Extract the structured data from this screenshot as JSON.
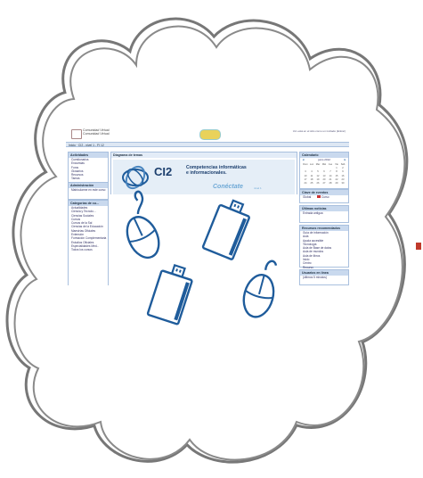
{
  "page": {
    "header": {
      "logo_text_line1": "Comunidad Virtual",
      "logo_text_line2": "Comunidad Virtual",
      "top_link": "Ud. está en el sitio como un invitado (Entrar)"
    },
    "breadcrumb": "Inicio · CI2 - nivel 1 - FI 12",
    "left_blocks": {
      "activities": {
        "title": "Actividades",
        "items": [
          "Cuestionarios",
          "Encuestas",
          "Foros",
          "Glosarios",
          "Recursos",
          "Tareas"
        ]
      },
      "admin": {
        "title": "Administración",
        "items": [
          "Matricularme en este curso"
        ]
      },
      "categories": {
        "title": "Categorías de cu...",
        "items": [
          "Actualidades",
          "Ciencia y Tecnolo...",
          "Ciencias Sociales",
          "Cursos",
          "Cursos de la Sal",
          "Ciencias de la Educación",
          "Maestrías Oficiales",
          "Extensión",
          "Formación Complementaria",
          "Estudios Oficiales",
          "Especialidades Med...",
          "Todos los cursos"
        ]
      }
    },
    "center": {
      "block_title": "Diagrama de temas",
      "ci2": "CI2",
      "competencias_line1": "Competencias informáticas",
      "competencias_line2": "e informacionales.",
      "conectate": "Conéctate",
      "nivel": "nivel 1"
    },
    "calendar": {
      "title": "Calendario",
      "month": "junio 2012",
      "days": [
        "Dom",
        "Lun",
        "Mar",
        "Mié",
        "Jue",
        "Vie",
        "Sáb"
      ],
      "numbers": [
        "",
        "",
        "",
        "",
        "",
        "1",
        "2",
        "3",
        "4",
        "5",
        "6",
        "7",
        "8",
        "9",
        "10",
        "11",
        "12",
        "13",
        "14",
        "15",
        "16",
        "17",
        "18",
        "19",
        "20",
        "21",
        "22",
        "23",
        "24",
        "25",
        "26",
        "27",
        "28",
        "29",
        "30"
      ]
    },
    "right_blocks": {
      "events_title": "Clave de eventos",
      "events_items": [
        "Global",
        "Curso"
      ],
      "news_title": "Últimas noticias",
      "news_item": "Entrada antigua",
      "resources_title": "Recursos recomendados",
      "resources_items": [
        "Guía de información",
        "Aula",
        "Ayuda accesible",
        "Tecnología",
        "Aula de Base de datos",
        "Aula de mundos",
        "Aula de libros",
        "Inicio",
        "Centro",
        "Recurso"
      ],
      "users_title": "Usuarios en línea",
      "users_item": "(últimos 5 minutos)"
    },
    "icons": [
      "mouse-icon",
      "usb-drive-icon",
      "usb-drive-icon",
      "mouse-icon"
    ],
    "colors": {
      "icon_blue": "#1f5c9b",
      "block_header": "#c9d9ee",
      "cloud_outline": "#7a7a7a"
    }
  }
}
